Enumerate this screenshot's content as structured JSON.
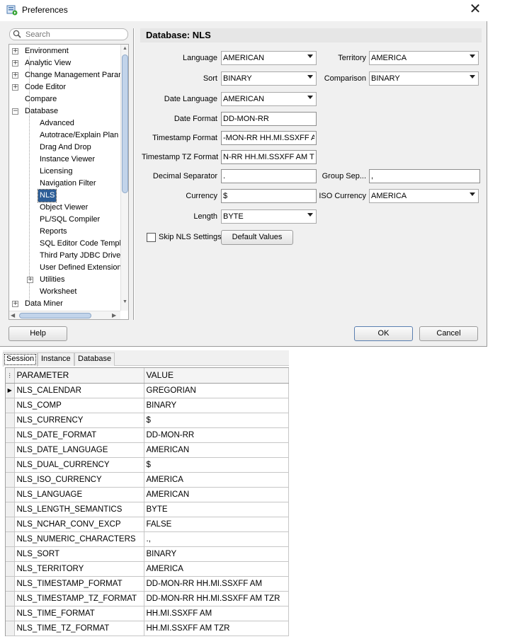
{
  "window": {
    "title": "Preferences",
    "close_glyph": "✕"
  },
  "search": {
    "placeholder": "Search"
  },
  "tree": {
    "items": [
      {
        "label": "Environment",
        "expander": "+"
      },
      {
        "label": "Analytic View",
        "expander": "+"
      },
      {
        "label": "Change Management Paran",
        "expander": "+"
      },
      {
        "label": "Code Editor",
        "expander": "+"
      },
      {
        "label": "Compare",
        "expander": ""
      },
      {
        "label": "Database",
        "expander": "−"
      },
      {
        "label": "Advanced",
        "expander": ""
      },
      {
        "label": "Autotrace/Explain Plan",
        "expander": ""
      },
      {
        "label": "Drag And Drop",
        "expander": ""
      },
      {
        "label": "Instance Viewer",
        "expander": ""
      },
      {
        "label": "Licensing",
        "expander": ""
      },
      {
        "label": "Navigation Filter",
        "expander": ""
      },
      {
        "label": "NLS",
        "expander": "",
        "selected": true
      },
      {
        "label": "Object Viewer",
        "expander": ""
      },
      {
        "label": "PL/SQL Compiler",
        "expander": ""
      },
      {
        "label": "Reports",
        "expander": ""
      },
      {
        "label": "SQL Editor Code Templa",
        "expander": ""
      },
      {
        "label": "Third Party JDBC Driver",
        "expander": ""
      },
      {
        "label": "User Defined Extension",
        "expander": ""
      },
      {
        "label": "Utilities",
        "expander": "+"
      },
      {
        "label": "Worksheet",
        "expander": ""
      },
      {
        "label": "Data Miner",
        "expander": "+"
      }
    ]
  },
  "panel": {
    "title": "Database: NLS",
    "language": {
      "label": "Language",
      "value": "AMERICAN"
    },
    "territory": {
      "label": "Territory",
      "value": "AMERICA"
    },
    "sort": {
      "label": "Sort",
      "value": "BINARY"
    },
    "comparison": {
      "label": "Comparison",
      "value": "BINARY"
    },
    "date_language": {
      "label": "Date Language",
      "value": "AMERICAN"
    },
    "date_format": {
      "label": "Date Format",
      "value": "DD-MON-RR"
    },
    "timestamp_format": {
      "label": "Timestamp Format",
      "value": "-MON-RR HH.MI.SSXFF AM"
    },
    "timestamp_tz_format": {
      "label": "Timestamp TZ Format",
      "value": "N-RR HH.MI.SSXFF AM TZR"
    },
    "decimal_separator": {
      "label": "Decimal Separator",
      "value": "."
    },
    "group_separator": {
      "label": "Group Sep...",
      "value": ","
    },
    "currency": {
      "label": "Currency",
      "value": "$"
    },
    "iso_currency": {
      "label": "ISO Currency",
      "value": "AMERICA"
    },
    "length": {
      "label": "Length",
      "value": "BYTE"
    },
    "skip_nls": {
      "label": "Skip NLS Settings",
      "checked": false
    },
    "default_values_label": "Default Values"
  },
  "buttons": {
    "help": "Help",
    "ok": "OK",
    "cancel": "Cancel"
  },
  "result_tabs": [
    "Session",
    "Instance",
    "Database"
  ],
  "grid": {
    "headers": [
      "PARAMETER",
      "VALUE"
    ],
    "rows": [
      [
        "NLS_CALENDAR",
        "GREGORIAN"
      ],
      [
        "NLS_COMP",
        "BINARY"
      ],
      [
        "NLS_CURRENCY",
        "$"
      ],
      [
        "NLS_DATE_FORMAT",
        "DD-MON-RR"
      ],
      [
        "NLS_DATE_LANGUAGE",
        "AMERICAN"
      ],
      [
        "NLS_DUAL_CURRENCY",
        "$"
      ],
      [
        "NLS_ISO_CURRENCY",
        "AMERICA"
      ],
      [
        "NLS_LANGUAGE",
        "AMERICAN"
      ],
      [
        "NLS_LENGTH_SEMANTICS",
        "BYTE"
      ],
      [
        "NLS_NCHAR_CONV_EXCP",
        "FALSE"
      ],
      [
        "NLS_NUMERIC_CHARACTERS",
        ".,"
      ],
      [
        "NLS_SORT",
        "BINARY"
      ],
      [
        "NLS_TERRITORY",
        "AMERICA"
      ],
      [
        "NLS_TIMESTAMP_FORMAT",
        "DD-MON-RR HH.MI.SSXFF AM"
      ],
      [
        "NLS_TIMESTAMP_TZ_FORMAT",
        "DD-MON-RR HH.MI.SSXFF AM TZR"
      ],
      [
        "NLS_TIME_FORMAT",
        "HH.MI.SSXFF AM"
      ],
      [
        "NLS_TIME_TZ_FORMAT",
        "HH.MI.SSXFF AM TZR"
      ]
    ]
  },
  "colors": {
    "selection": "#2d5e97",
    "dialog_bg": "#f0f0f0",
    "scroll_thumb": "#c2d4ea"
  }
}
